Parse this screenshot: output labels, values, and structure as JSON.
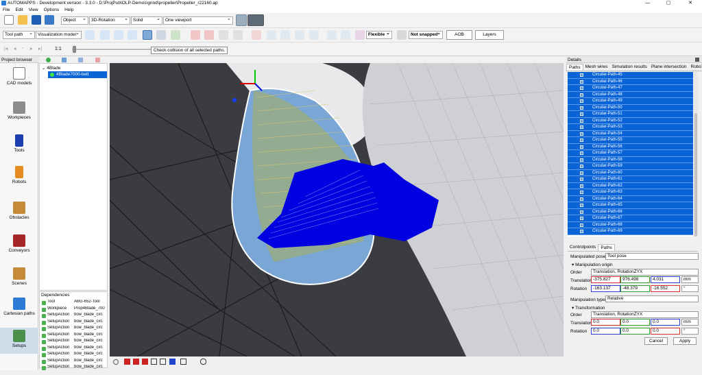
{
  "window": {
    "title": "AUTOMAPPS - Development version - 3.3.0 - D:\\ProjPub\\OLP-Demos\\grind\\propeller\\Propeller_r22160.ap",
    "minimize": "—",
    "maximize": "▢",
    "close": "✕"
  },
  "menu": [
    "File",
    "Edit",
    "View",
    "Options",
    "Help"
  ],
  "toolbar1": {
    "object_select": "Object",
    "rotation_select": "3D-Rotation",
    "shading_select": "Solid",
    "viewport_select": "One viewport"
  },
  "toolbar2": {
    "toolpath_select": "Tool path",
    "visualization_select": "Visualization model",
    "flexible_select": "Flexible",
    "snap_select": "Not snapped",
    "aob_button": "AOB",
    "layers_button": "Layers"
  },
  "toolbar3": {
    "zoom_value": "1:1",
    "tooltip": "Check collision of all selected paths."
  },
  "left_panel": {
    "title": "Project browser",
    "items": [
      "CAD models",
      "Workpieces",
      "Tools",
      "Robots",
      "Obstacles",
      "Conveyors",
      "Scenes",
      "Cartesian paths",
      "Setups"
    ]
  },
  "tree": {
    "root": "4Blade",
    "child": "4Blade7000-belt"
  },
  "dependencies": {
    "title": "Dependencies",
    "rows": [
      {
        "type": "Tool",
        "name": "ABG-652-Tool"
      },
      {
        "type": "Workpiece",
        "name": "Prop4Blade_700"
      },
      {
        "type": "SetupAction",
        "name": "bow_blade_circ"
      },
      {
        "type": "SetupAction",
        "name": "bow_blade_circ"
      },
      {
        "type": "SetupAction",
        "name": "bow_blade_circ"
      },
      {
        "type": "SetupAction",
        "name": "bow_blade_circ"
      },
      {
        "type": "SetupAction",
        "name": "bow_blade_circ"
      },
      {
        "type": "SetupAction",
        "name": "bow_blade_circ"
      },
      {
        "type": "SetupAction",
        "name": "bow_blade_circ"
      },
      {
        "type": "SetupAction",
        "name": "bow_blade_circ"
      },
      {
        "type": "SetupAction",
        "name": "bow_blade_circ"
      }
    ]
  },
  "details": {
    "title": "Details",
    "tabs": [
      "Paths",
      "Mesh wires",
      "Simulation results",
      "Plane intersection",
      "RoboTra"
    ],
    "paths": [
      "Circular-Path-45",
      "Circular-Path-46",
      "Circular-Path-47",
      "Circular-Path-48",
      "Circular-Path-49",
      "Circular-Path-50",
      "Circular-Path-51",
      "Circular-Path-52",
      "Circular-Path-53",
      "Circular-Path-54",
      "Circular-Path-55",
      "Circular-Path-56",
      "Circular-Path-57",
      "Circular-Path-58",
      "Circular-Path-59",
      "Circular-Path-60",
      "Circular-Path-61",
      "Circular-Path-62",
      "Circular-Path-63",
      "Circular-Path-64",
      "Circular-Path-65",
      "Circular-Path-66",
      "Circular-Path-67",
      "Circular-Path-68",
      "Circular-Path-69"
    ],
    "sub_tabs": [
      "Controlpoints",
      "Paths"
    ],
    "manipulated_pose_label": "Manipulated pose",
    "manipulated_pose_value": "Tool pose",
    "manipulation_origin_label": "Manipulation origin",
    "order_label": "Order",
    "order_value": "Translation, RotationZYX",
    "translation_label": "Translation",
    "translation": [
      "-375.827",
      "976.498",
      "4.031"
    ],
    "translation_unit": "mm",
    "rotation_label": "Rotation",
    "rotation": [
      "-163.137",
      "-48.379",
      "-16.552"
    ],
    "rotation_unit": "°",
    "manipulation_type_label": "Manipulation type",
    "manipulation_type_value": "Relative",
    "transformation_label": "Transformation",
    "order2_value": "Translation, RotationZYX",
    "translation2": [
      "0.0",
      "0.0",
      "0.0"
    ],
    "rotation2": [
      "0.0",
      "0.0",
      "0.0"
    ],
    "cancel_button": "Cancel",
    "apply_button": "Apply"
  }
}
